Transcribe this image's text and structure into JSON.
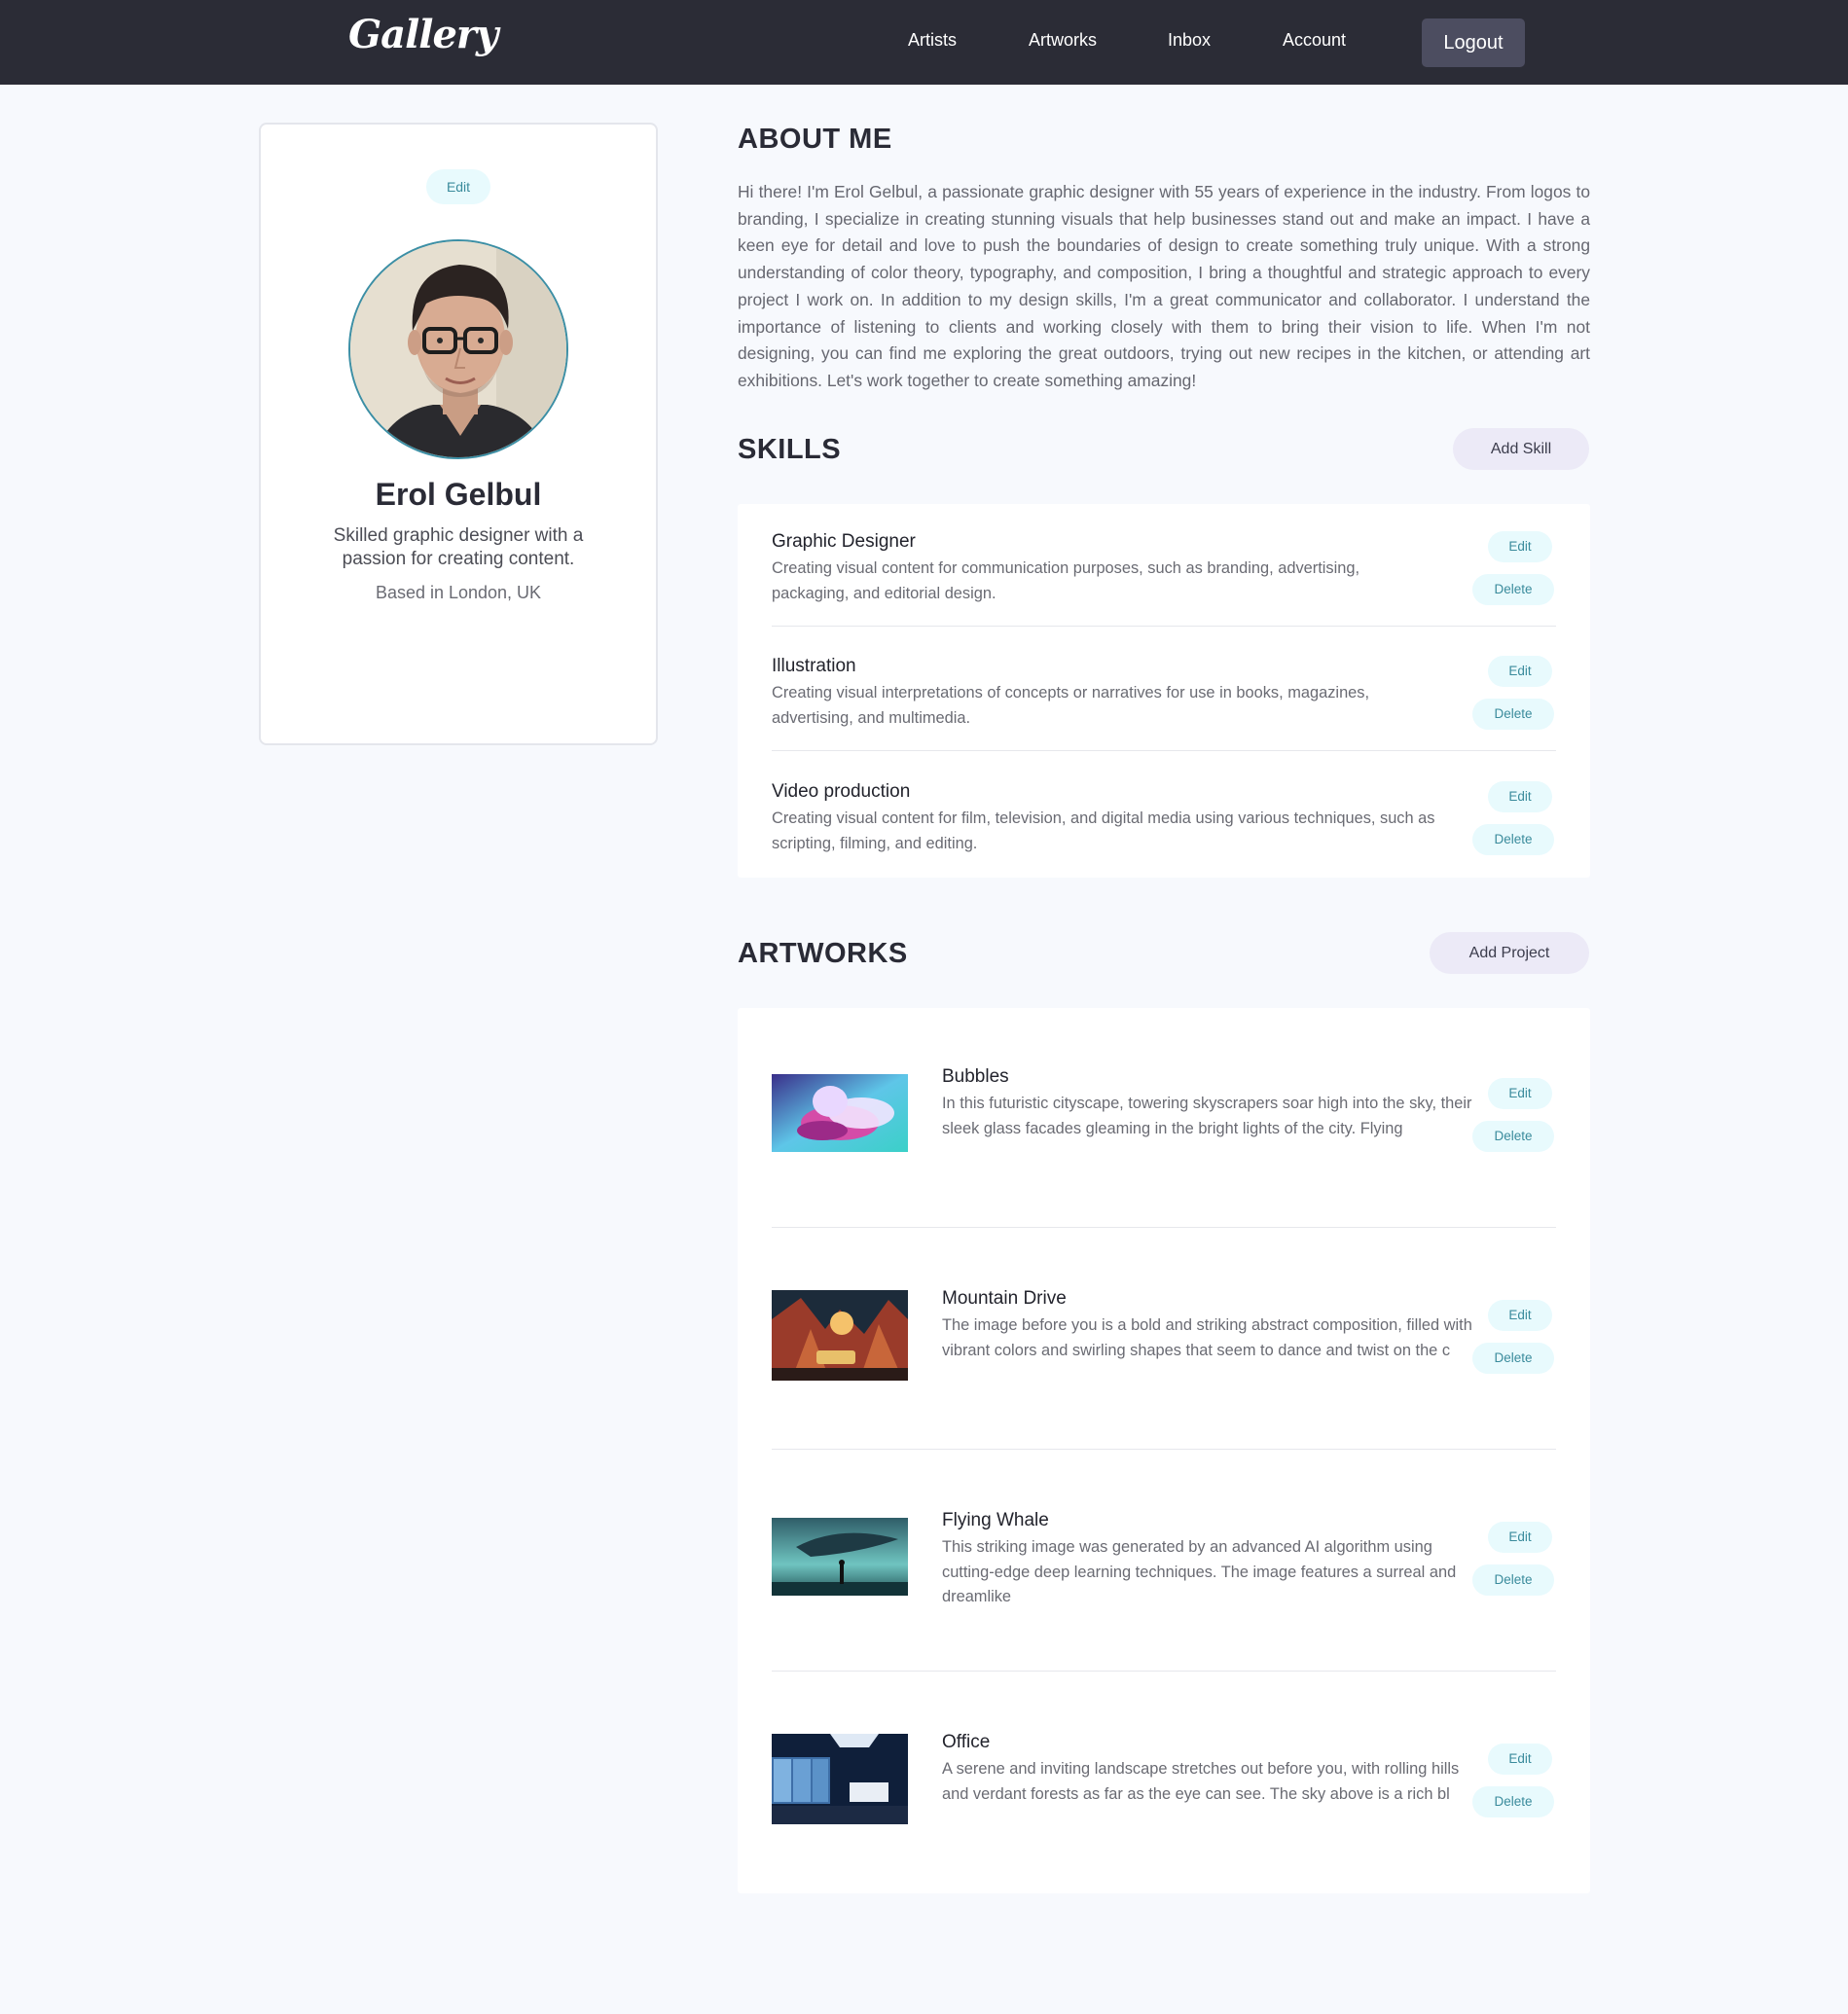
{
  "header": {
    "brand": "Gallery",
    "nav": [
      "Artists",
      "Artworks",
      "Inbox",
      "Account"
    ],
    "logout_label": "Logout"
  },
  "profile": {
    "edit_label": "Edit",
    "name": "Erol Gelbul",
    "tagline": "Skilled graphic designer with a passion for creating content.",
    "location": "Based in London, UK"
  },
  "about": {
    "title": "ABOUT ME",
    "text": "Hi there! I'm Erol Gelbul, a passionate graphic designer with 55 years of experience in the industry. From logos to branding, I specialize in creating stunning visuals that help businesses stand out and make an impact. I have a keen eye for detail and love to push the boundaries of design to create something truly unique. With a strong understanding of color theory, typography, and composition, I bring a thoughtful and strategic approach to every project I work on. In addition to my design skills, I'm a great communicator and collaborator. I understand the importance of listening to clients and working closely with them to bring their vision to life. When I'm not designing, you can find me exploring the great outdoors, trying out new recipes in the kitchen, or attending art exhibitions. Let's work together to create something amazing!"
  },
  "skills": {
    "title": "SKILLS",
    "add_label": "Add Skill",
    "edit_label": "Edit",
    "delete_label": "Delete",
    "items": [
      {
        "title": "Graphic Designer",
        "desc": "Creating visual content for communication purposes, such as branding, advertising, packaging, and editorial design."
      },
      {
        "title": "Illustration",
        "desc": "Creating visual interpretations of concepts or narratives for use in books, magazines, advertising, and multimedia."
      },
      {
        "title": "Video production",
        "desc": "Creating visual content for film, television, and digital media using various techniques, such as scripting, filming, and editing."
      }
    ]
  },
  "artworks": {
    "title": "ARTWORKS",
    "add_label": "Add Project",
    "edit_label": "Edit",
    "delete_label": "Delete",
    "items": [
      {
        "title": "Bubbles",
        "desc": "In this futuristic cityscape, towering skyscrapers soar high into the sky, their sleek glass facades gleaming in the bright lights of the city. Flying"
      },
      {
        "title": "Mountain Drive",
        "desc": "The image before you is a bold and striking abstract composition, filled with vibrant colors and swirling shapes that seem to dance and twist on the c"
      },
      {
        "title": "Flying Whale",
        "desc": "This striking image was generated by an advanced AI algorithm using cutting-edge deep learning techniques. The image features a surreal and dreamlike"
      },
      {
        "title": "Office",
        "desc": "A serene and inviting landscape stretches out before you, with rolling hills and verdant forests as far as the eye can see. The sky above is a rich bl"
      }
    ]
  },
  "colors": {
    "header_bg": "#2b2c36",
    "page_bg": "#f7f9fd",
    "pill_bg": "#e8fafd",
    "pill_text": "#3a8b9c",
    "add_button_bg": "#eceaf7"
  }
}
